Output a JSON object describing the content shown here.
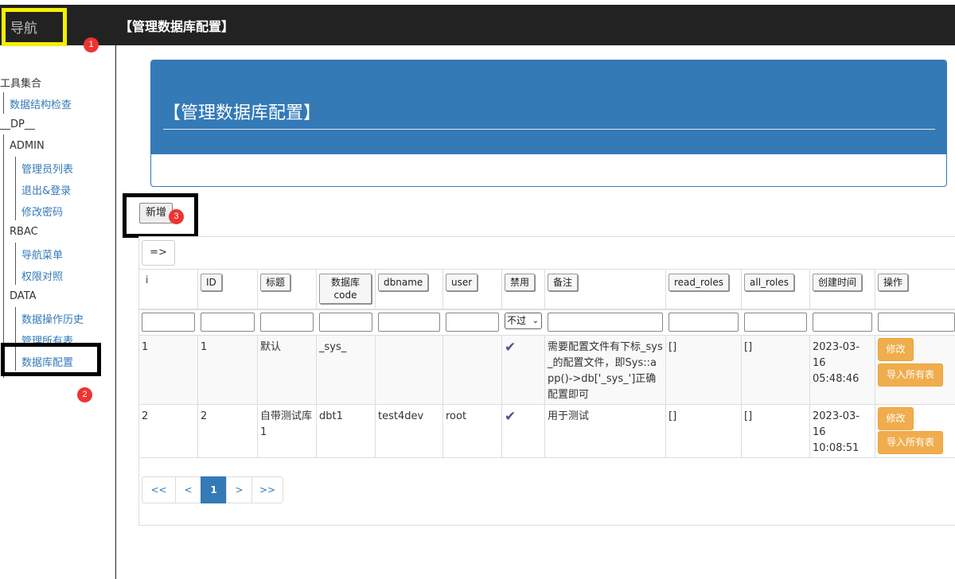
{
  "nav": {
    "title": "导航",
    "badge1": "1",
    "badge2": "2",
    "groups": {
      "tools": "工具集合",
      "tools_item": "数据结构检查",
      "dp": "__DP__",
      "admin": "ADMIN",
      "admin_items": [
        "管理员列表",
        "退出&登录",
        "修改密码"
      ],
      "rbac": "RBAC",
      "rbac_items": [
        "导航菜单",
        "权限对照"
      ],
      "data": "DATA",
      "data_items": [
        "数据操作历史",
        "管理所有表",
        "数据库配置"
      ]
    }
  },
  "header": {
    "title": "【管理数据库配置】"
  },
  "panel": {
    "title": "【管理数据库配置】"
  },
  "toolbar": {
    "add_label": "新增",
    "badge3": "3",
    "arrow_label": "=>"
  },
  "table": {
    "headers": [
      "i",
      "ID",
      "标题",
      "数据库code",
      "dbname",
      "user",
      "禁用",
      "备注",
      "read_roles",
      "all_roles",
      "创建时间",
      "操作"
    ],
    "header_code_line1": "数据库",
    "header_code_line2": "code",
    "filter_select": "不过",
    "rows": [
      {
        "i": "1",
        "id": "1",
        "title": "默认",
        "code": "_sys_",
        "dbname": "",
        "user": "",
        "disabled": "✔",
        "note": "需要配置文件有下标_sys_的配置文件，即Sys::app()->db['_sys_']正确配置即可",
        "read_roles": "[]",
        "all_roles": "[]",
        "created_date": "2023-03-16",
        "created_time": "05:48:46",
        "edit": "修改",
        "import": "导入所有表"
      },
      {
        "i": "2",
        "id": "2",
        "title": "自带测试库1",
        "code": "dbt1",
        "dbname": "test4dev",
        "user": "root",
        "disabled": "✔",
        "note": "用于测试",
        "read_roles": "[]",
        "all_roles": "[]",
        "created_date": "2023-03-16",
        "created_time": "10:08:51",
        "edit": "修改",
        "import": "导入所有表"
      }
    ]
  },
  "pagination": {
    "first": "<<",
    "prev": "<",
    "current": "1",
    "next": ">",
    "last": ">>"
  },
  "colors": {
    "accent": "#337ab7",
    "warning": "#f0ad4e",
    "dark": "#222222",
    "highlight": "#f5f000",
    "badge": "#ee3333"
  }
}
